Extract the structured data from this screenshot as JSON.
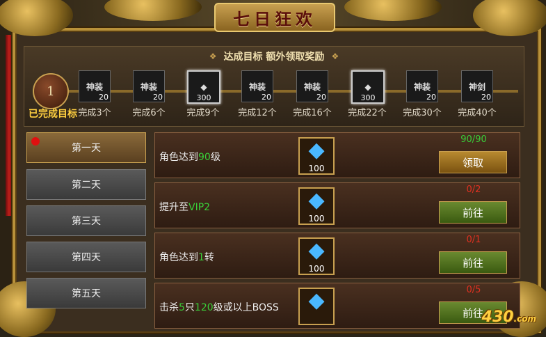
{
  "title": "七日狂欢",
  "milestone_header": "达成目标  额外领取奖励",
  "completed": {
    "count": "1",
    "label": "已完成目标"
  },
  "milestones": [
    {
      "glyph": "神装",
      "qty": "20",
      "caption": "完成3个",
      "type": "item"
    },
    {
      "glyph": "神装",
      "qty": "20",
      "caption": "完成6个",
      "type": "item"
    },
    {
      "glyph": "◆",
      "qty": "300",
      "caption": "完成9个",
      "type": "diamond"
    },
    {
      "glyph": "神装",
      "qty": "20",
      "caption": "完成12个",
      "type": "item"
    },
    {
      "glyph": "神装",
      "qty": "20",
      "caption": "完成16个",
      "type": "item"
    },
    {
      "glyph": "◆",
      "qty": "300",
      "caption": "完成22个",
      "type": "diamond"
    },
    {
      "glyph": "神装",
      "qty": "20",
      "caption": "完成30个",
      "type": "item"
    },
    {
      "glyph": "神剑",
      "qty": "20",
      "caption": "完成40个",
      "type": "item"
    }
  ],
  "days": [
    {
      "label": "第一天",
      "active": true,
      "has_dot": true
    },
    {
      "label": "第二天",
      "active": false
    },
    {
      "label": "第三天",
      "active": false
    },
    {
      "label": "第四天",
      "active": false
    },
    {
      "label": "第五天",
      "active": false
    }
  ],
  "tasks": [
    {
      "desc_pre": "角色达到",
      "desc_hl": "90",
      "desc_post": "级",
      "reward_qty": "100",
      "progress": "90/90",
      "status": "done",
      "button": "领取"
    },
    {
      "desc_pre": "提升至",
      "desc_hl": "VIP2",
      "desc_post": "",
      "reward_qty": "100",
      "progress": "0/2",
      "status": "todo",
      "button": "前往"
    },
    {
      "desc_pre": "角色达到",
      "desc_hl": "1",
      "desc_post": "转",
      "reward_qty": "100",
      "progress": "0/1",
      "status": "todo",
      "button": "前往"
    },
    {
      "desc_pre": "击杀",
      "desc_hl": "5",
      "desc_mid": "只",
      "desc_hl2": "120",
      "desc_post": "级或以上BOSS",
      "reward_qty": "",
      "progress": "0/5",
      "status": "todo",
      "button": "前往"
    }
  ],
  "watermark": {
    "text": "430",
    "suffix": ".com"
  },
  "colors": {
    "accent_gold": "#c8a050",
    "complete_green": "#39d039",
    "incomplete_red": "#e03020",
    "active_tab": "#8a6a3a"
  }
}
